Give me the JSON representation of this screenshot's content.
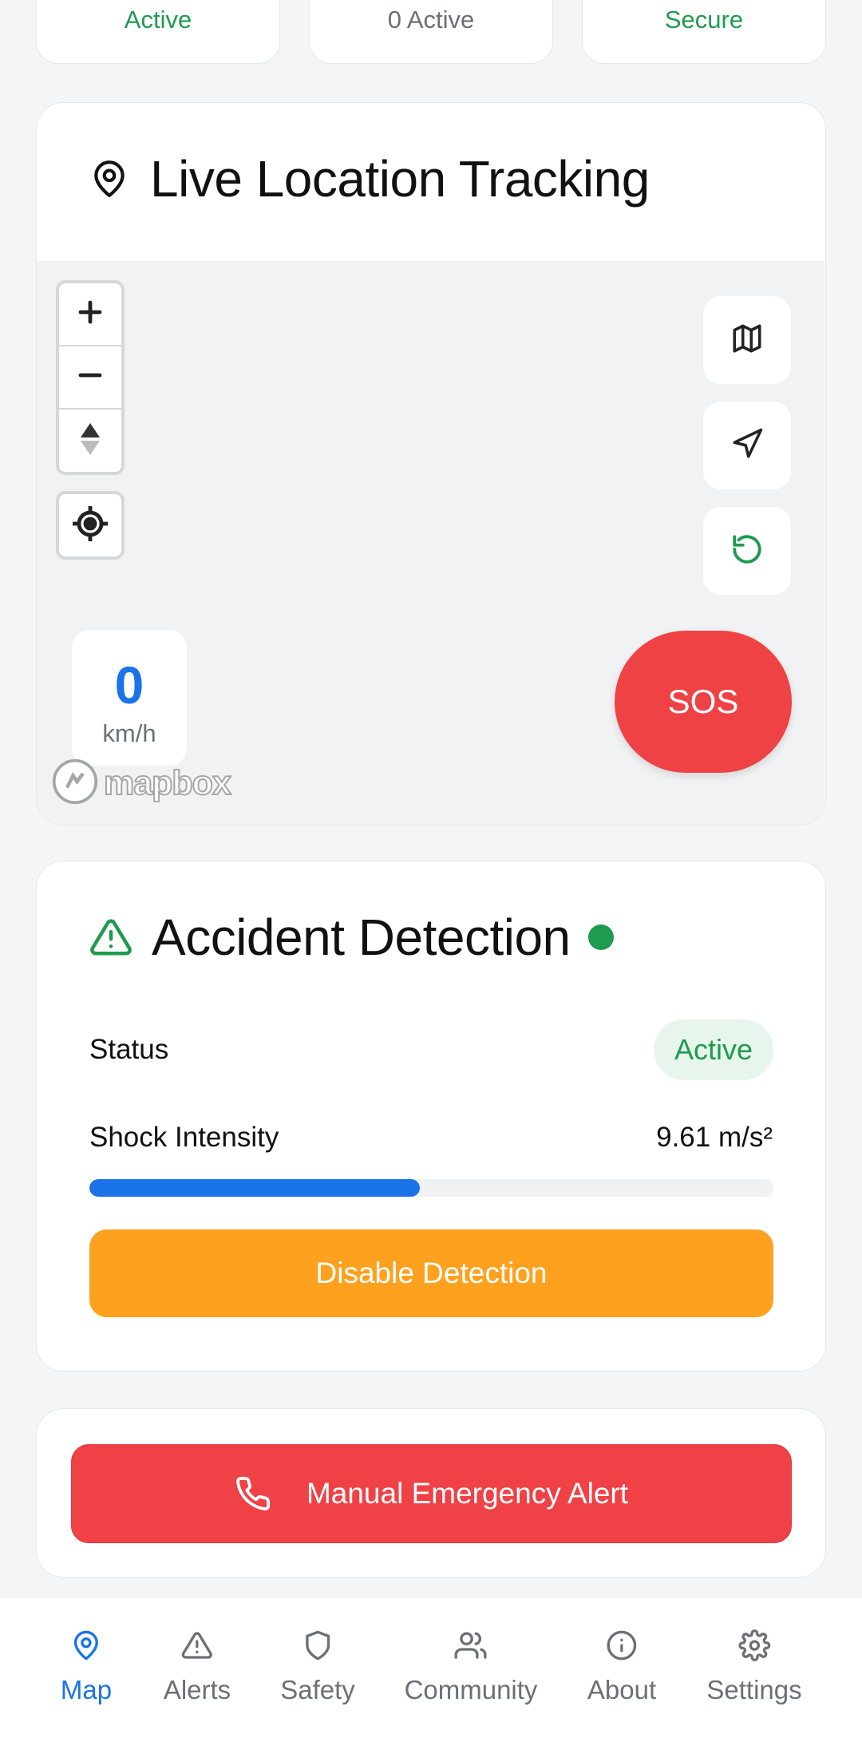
{
  "status_cards": [
    {
      "value": "Active",
      "color": "#1e9b4f"
    },
    {
      "value": "0 Active",
      "color": "#6b7077"
    },
    {
      "value": "Secure",
      "color": "#1e9b4f"
    }
  ],
  "location_card": {
    "title": "Live Location Tracking",
    "title_icon": "map-pin-icon",
    "map": {
      "zoom_in_icon": "plus-icon",
      "zoom_out_icon": "minus-icon",
      "compass_icon": "compass-icon",
      "locate_icon": "crosshair-icon",
      "controls": [
        {
          "name": "map-layers-button",
          "icon": "map-icon"
        },
        {
          "name": "navigate-button",
          "icon": "navigation-arrow-icon"
        },
        {
          "name": "refresh-button",
          "icon": "refresh-icon"
        }
      ],
      "speed_value": "0",
      "speed_unit": "km/h",
      "attribution": "mapbox",
      "sos_label": "SOS"
    }
  },
  "accident_card": {
    "title": "Accident Detection",
    "title_icon": "warning-triangle-icon",
    "indicator_color": "#1e9b4f",
    "status_label": "Status",
    "status_value": "Active",
    "shock_label": "Shock Intensity",
    "shock_value": "9.61 m/s²",
    "shock_fraction": 0.483,
    "disable_label": "Disable Detection"
  },
  "emergency": {
    "label": "Manual Emergency Alert",
    "icon": "phone-icon"
  },
  "bottom_nav": [
    {
      "label": "Map",
      "icon": "map-pin-icon",
      "active": true
    },
    {
      "label": "Alerts",
      "icon": "warning-triangle-icon",
      "active": false
    },
    {
      "label": "Safety",
      "icon": "shield-icon",
      "active": false
    },
    {
      "label": "Community",
      "icon": "users-icon",
      "active": false
    },
    {
      "label": "About",
      "icon": "info-icon",
      "active": false
    },
    {
      "label": "Settings",
      "icon": "gear-icon",
      "active": false
    }
  ],
  "colors": {
    "accent": "#1a73e8",
    "sos": "#ee4245",
    "warning": "#fda11e",
    "success": "#1e9b4f"
  }
}
